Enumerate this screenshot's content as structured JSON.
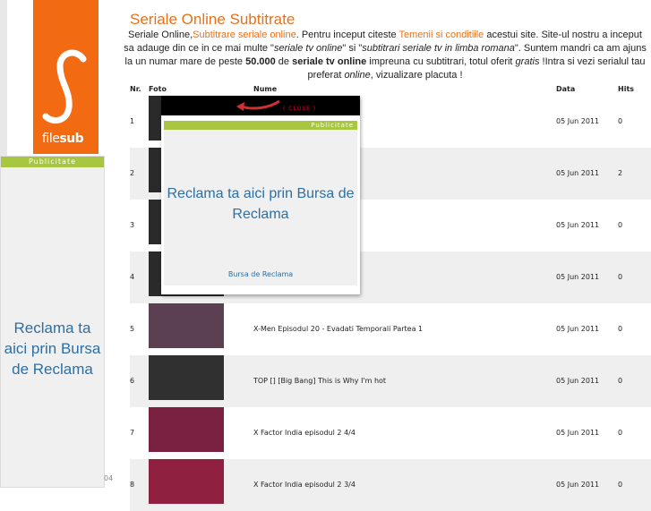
{
  "logo": {
    "brand_light": "file",
    "brand_bold": "sub"
  },
  "left_ad": {
    "bar": "Publicitate",
    "text": "Reclama ta aici prin Bursa de Reclama",
    "fragment": "04"
  },
  "page": {
    "title": "Seriale Online Subtitrate",
    "intro_1": "Seriale Online,",
    "intro_link_1": "Subtitrare seriale online",
    "intro_2": ". Pentru inceput citeste ",
    "intro_link_2": "Temenii si conditiile",
    "intro_3": " acestui site. Site-ul nostru a inceput sa adauge din ce in ce mai multe \"",
    "intro_em_1": "seriale tv online",
    "intro_4": "\" si \"",
    "intro_em_2": "subtitrari seriale tv in limba romana",
    "intro_5": "\". Suntem mandri ca am ajuns la un numar mare de peste ",
    "intro_strong_1": "50.000",
    "intro_6": " de ",
    "intro_strong_2": "seriale tv online",
    "intro_7": " impreuna cu subtitrari, totul oferit ",
    "intro_em_3": "gratis",
    "intro_8": " !Intra si vezi serialul tau preferat ",
    "intro_em_4": "online",
    "intro_9": ", vizualizare placuta !"
  },
  "table": {
    "headers": {
      "nr": "Nr.",
      "foto": "Foto",
      "nume": "Nume",
      "data": "Data",
      "hits": "Hits"
    },
    "rows": [
      {
        "nr": "1",
        "name": "",
        "date": "05 Jun 2011",
        "hits": "0"
      },
      {
        "nr": "2",
        "name": "",
        "date": "05 Jun 2011",
        "hits": "2"
      },
      {
        "nr": "3",
        "name": "",
        "date": "05 Jun 2011",
        "hits": "0"
      },
      {
        "nr": "4",
        "name": "",
        "date": "05 Jun 2011",
        "hits": "0"
      },
      {
        "nr": "5",
        "name": "X-Men Episodul 20 - Evadati Temporali Partea 1",
        "date": "05 Jun 2011",
        "hits": "0"
      },
      {
        "nr": "6",
        "name": "TOP [] [Big Bang] This is Why I'm hot",
        "date": "05 Jun 2011",
        "hits": "0"
      },
      {
        "nr": "7",
        "name": "X Factor India episodul 2 4/4",
        "date": "05 Jun 2011",
        "hits": "0"
      },
      {
        "nr": "8",
        "name": "X Factor India episodul 2 3/4",
        "date": "05 Jun 2011",
        "hits": "0"
      }
    ]
  },
  "popup": {
    "close": "( CLOSE )",
    "bar": "Publicitate",
    "text": "Reclama ta aici prin Bursa de Reclama",
    "small": "Bursa de Reclama"
  }
}
